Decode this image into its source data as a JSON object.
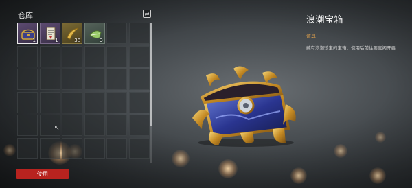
{
  "warehouse": {
    "title": "仓库",
    "sort_icon": "swap-icon",
    "slots": [
      {
        "kind": "treasure-chest",
        "qty": "1",
        "selected": true
      },
      {
        "kind": "scroll",
        "qty": "1"
      },
      {
        "kind": "golden-horn",
        "qty": "38"
      },
      {
        "kind": "green-bundle",
        "qty": "3"
      }
    ],
    "total_slots": 36
  },
  "use_button": {
    "label": "使用"
  },
  "item": {
    "name": "浪潮宝箱",
    "category": "道具",
    "description": "藏有浪潮珍宝的宝箱，使用后前往要宝阁开启"
  },
  "colors": {
    "accent_red": "#b8231f",
    "category_orange": "#e3a24b"
  }
}
